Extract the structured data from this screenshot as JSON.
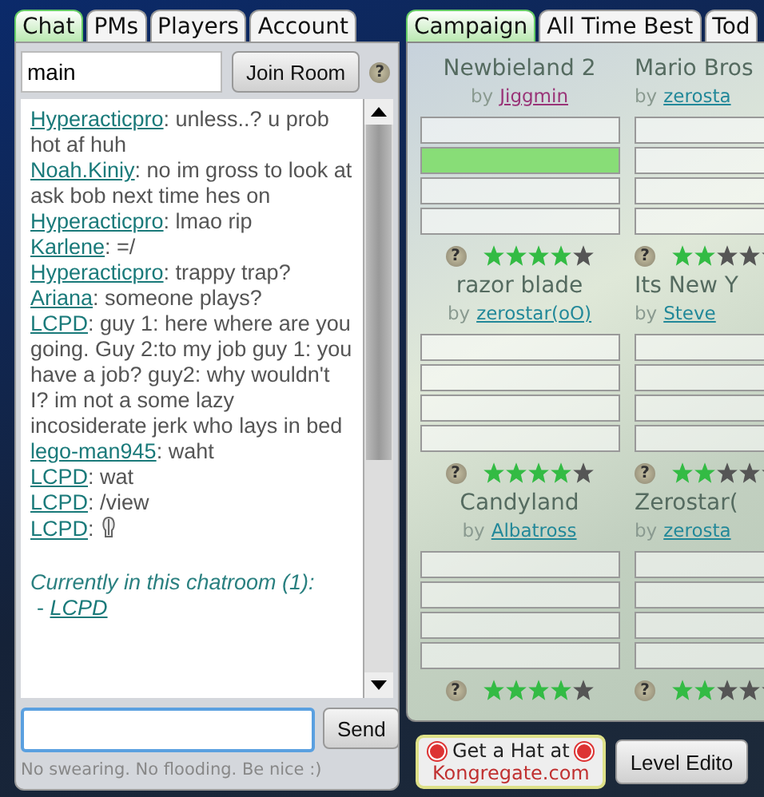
{
  "chat_panel": {
    "tabs": [
      {
        "label": "Chat",
        "selected": true
      },
      {
        "label": "PMs",
        "selected": false
      },
      {
        "label": "Players",
        "selected": false
      },
      {
        "label": "Account",
        "selected": false
      }
    ],
    "room_field": {
      "value": "main"
    },
    "join_button": "Join Room",
    "help": "?",
    "messages": [
      {
        "user": "Hyperacticpro",
        "text": ": unless..? u prob hot af huh"
      },
      {
        "user": "Noah.Kiniy",
        "text": ": no im gross to look at ask bob next time hes on"
      },
      {
        "user": "Hyperacticpro",
        "text": ": lmao rip"
      },
      {
        "user": "Karlene",
        "text": ": =/"
      },
      {
        "user": "Hyperacticpro",
        "text": ": trappy trap?"
      },
      {
        "user": "Ariana",
        "text": ": someone plays?"
      },
      {
        "user": "LCPD",
        "text": ": guy 1: here where are you going. Guy 2:to my job guy 1: you have a job? guy2: why wouldn't I? im not a some lazy incosiderate jerk who lays in bed"
      },
      {
        "user": "lego-man945",
        "text": ": waht"
      },
      {
        "user": "LCPD",
        "text": ": wat"
      },
      {
        "user": "LCPD",
        "text": ": /view"
      },
      {
        "user": "LCPD",
        "text": ":",
        "kind": "glyph"
      }
    ],
    "room_note": "Currently in this chatroom (1):",
    "room_users": [
      {
        "prefix": "-",
        "name": "LCPD"
      }
    ],
    "send_button": "Send",
    "rules": "No swearing. No flooding. Be nice :)"
  },
  "levels_panel": {
    "tabs": [
      {
        "label": "Campaign",
        "selected": true
      },
      {
        "label": "All Time Best",
        "selected": false
      },
      {
        "label": "Tod",
        "selected": false
      }
    ],
    "levels": [
      {
        "title": "Newbieland 2",
        "by": "by",
        "author": "Jiggmin",
        "color": "#993377",
        "slots": [
          false,
          true,
          false,
          false
        ],
        "help": "?",
        "stars": 4
      },
      {
        "title": "Mario Bros",
        "by": "by",
        "author": "zerosta",
        "color": "#228899",
        "slots": [
          false,
          false,
          false,
          false
        ],
        "help": "?",
        "stars": 2
      },
      {
        "title": "razor blade",
        "by": "by",
        "author": "zerostar(oO)",
        "color": "#228899",
        "slots": [
          false,
          false,
          false,
          false
        ],
        "help": "?",
        "stars": 4
      },
      {
        "title": "Its New Y",
        "by": "by",
        "author": "Steve",
        "color": "#228899",
        "slots": [
          false,
          false,
          false,
          false
        ],
        "help": "?",
        "stars": 2
      },
      {
        "title": "Candyland",
        "by": "by",
        "author": "Albatross",
        "color": "#228899",
        "slots": [
          false,
          false,
          false,
          false
        ],
        "help": "?",
        "stars": 4
      },
      {
        "title": "Zerostar(",
        "by": "by",
        "author": "zerosta",
        "color": "#228899",
        "slots": [
          false,
          false,
          false,
          false
        ],
        "help": "?",
        "stars": 2
      }
    ],
    "hat_button": {
      "line1": "Get a Hat at",
      "line2": "Kongregate.com"
    },
    "editor_button": "Level Edito"
  }
}
